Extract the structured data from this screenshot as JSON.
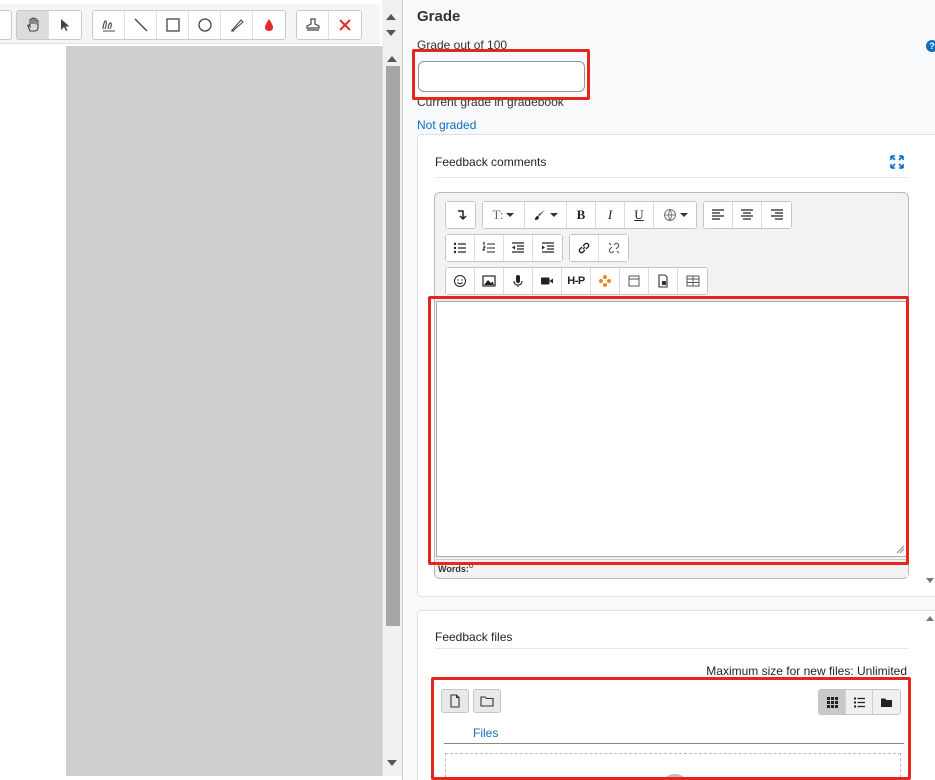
{
  "annotation_toolbar": {
    "groups": [
      [
        "hand-tool",
        "select-tool"
      ],
      [
        "pen-tool",
        "line-tool",
        "rectangle-tool",
        "oval-tool",
        "highlight-tool",
        "color-picker"
      ],
      [
        "stamp-tool",
        "delete-tool"
      ]
    ]
  },
  "grade": {
    "heading": "Grade",
    "label": "Grade out of 100",
    "value": "",
    "help_icon": "?",
    "current_grade_label": "Current grade in gradebook",
    "current_grade_value": "Not graded"
  },
  "feedback_comments": {
    "title": "Feedback comments",
    "words_label": "Words:",
    "words_count": "0",
    "toolbar_row1": [
      "undo-redo",
      "paragraph-styles",
      "text-color",
      "bold",
      "italic",
      "underline",
      "language",
      "align-left",
      "align-center",
      "align-right"
    ],
    "toolbar_row2": [
      "unordered-list",
      "ordered-list",
      "outdent",
      "indent",
      "link",
      "unlink"
    ],
    "toolbar_row3": [
      "emoji",
      "image",
      "record-audio",
      "record-video",
      "h5p",
      "h5p-content",
      "media",
      "file",
      "table"
    ],
    "bold_label": "B",
    "italic_label": "I",
    "underline_label": "U",
    "h5p_label": "H-P"
  },
  "feedback_files": {
    "title": "Feedback files",
    "max_size": "Maximum size for new files: Unlimited",
    "crumb": "Files"
  },
  "colors": {
    "accent": "#0f6cbf",
    "highlight": "#e8251c",
    "h5p_orange": "#e8891c"
  }
}
